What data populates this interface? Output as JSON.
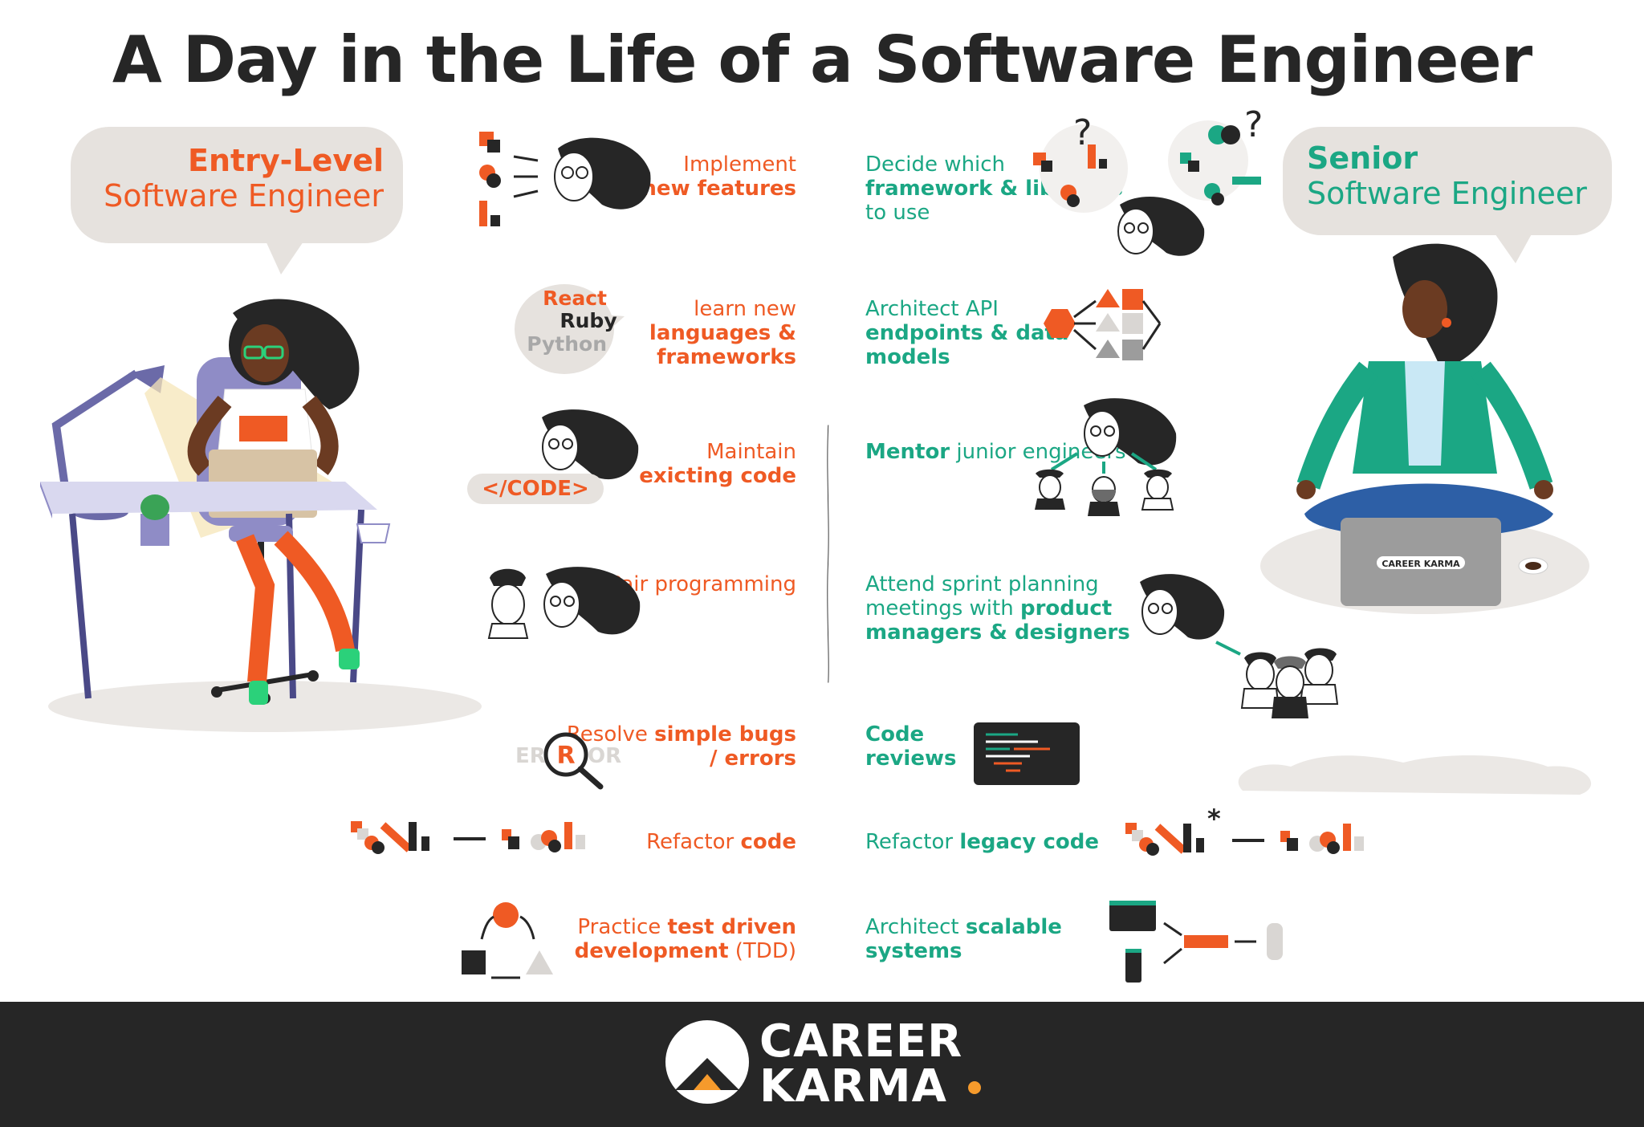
{
  "title": "A Day in the Life of a Software Engineer",
  "entry": {
    "level": "Entry-Level",
    "role": "Software Engineer",
    "tasks": [
      {
        "plain_before": "Implement",
        "bold": "new features",
        "plain_after": ""
      },
      {
        "plain_before": "learn new",
        "bold": "languages & frameworks",
        "plain_after": ""
      },
      {
        "plain_before": "Maintain",
        "bold": "exicting code",
        "plain_after": ""
      },
      {
        "plain_before": "Pair programming",
        "bold": "",
        "plain_after": ""
      },
      {
        "plain_before": "Resolve",
        "bold": "simple bugs / errors",
        "plain_after": ""
      },
      {
        "plain_before": "Refactor",
        "bold": "code",
        "plain_after": ""
      },
      {
        "plain_before": "Practice",
        "bold": "test driven development",
        "plain_after": "(TDD)"
      }
    ],
    "bubble_words": [
      "React",
      "Ruby",
      "Python"
    ],
    "code_tag": "</CODE>",
    "error_letters": [
      "ER",
      "R",
      "OR"
    ]
  },
  "senior": {
    "level": "Senior",
    "role": "Software Engineer",
    "tasks": [
      {
        "plain_before": "Decide which",
        "bold": "framework & libraries",
        "plain_after": "to use"
      },
      {
        "plain_before": "Architect API",
        "bold": "endpoints & data models",
        "plain_after": ""
      },
      {
        "plain_before": "",
        "bold": "Mentor",
        "plain_after": "junior engineers"
      },
      {
        "plain_before": "Attend sprint planning meetings with",
        "bold": "product managers & designers",
        "plain_after": ""
      },
      {
        "plain_before": "",
        "bold": "Code reviews",
        "plain_after": ""
      },
      {
        "plain_before": "Refactor",
        "bold": "legacy code",
        "plain_after": ""
      },
      {
        "plain_before": "Architect",
        "bold": "scalable systems",
        "plain_after": ""
      }
    ]
  },
  "laptop_brand": "CAREER KARMA.",
  "footer": {
    "line1": "CAREER",
    "line2": "KARMA"
  },
  "colors": {
    "orange": "#ef5a24",
    "green": "#1ba784",
    "dark": "#262626",
    "grey": "#e6e2de",
    "gold": "#f59a2c"
  }
}
